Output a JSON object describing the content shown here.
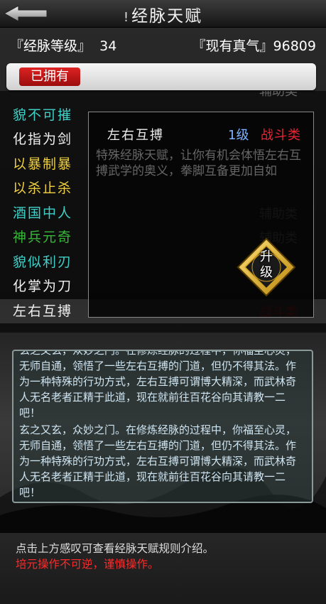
{
  "header": {
    "title": "经脉天赋",
    "info_mark": "!"
  },
  "stats": {
    "level_label": "『经脉等级』",
    "level_value": "34",
    "qi_label": "『现有真气』",
    "qi_value": "96809"
  },
  "filter": {
    "owned_label": "已拥有"
  },
  "list": [
    {
      "name": "",
      "cat": "辅助类",
      "color": "#d8c060"
    },
    {
      "name": "貌不可摧",
      "cat": "",
      "color": "#3fd0c8"
    },
    {
      "name": "化指为剑",
      "cat": "",
      "color": "#f0f0f0"
    },
    {
      "name": "以暴制暴",
      "cat": "",
      "color": "#f0d040"
    },
    {
      "name": "以杀止杀",
      "cat": "",
      "color": "#f0d040"
    },
    {
      "name": "酒国中人",
      "cat": "辅助类",
      "color": "#3fd0c8"
    },
    {
      "name": "神兵元奇",
      "cat": "辅助类",
      "color": "#38b83a"
    },
    {
      "name": "貌似利刃",
      "cat": "",
      "color": "#3fd0c8"
    },
    {
      "name": "化掌为刀",
      "cat": "",
      "color": "#f0f0f0"
    },
    {
      "name": "左右互搏",
      "cat": "战斗类",
      "color": "#f0f0f0"
    }
  ],
  "popup": {
    "name": "左右互搏",
    "level": "1级",
    "category": "战斗类",
    "description": "特殊经脉天赋，让你有机会体悟左右互搏武学的奥义，拳脚互备更加自如",
    "upgrade_label_1": "升",
    "upgrade_label_2": "级"
  },
  "story": {
    "paragraph_1": "玄之又玄，众妙之门。在修炼经脉的过程中，你福至心灵，无师自通，领悟了一些左右互搏的门道，但仍不得其法。作为一种特殊的行功方式，左右互搏可谓博大精深，而武林奇人无名老者正精于此道，现在就前往百花谷向其请教一二吧！",
    "paragraph_2": "玄之又玄，众妙之门。在修炼经脉的过程中，你福至心灵，无师自通，领悟了一些左右互搏的门道，但仍不得其法。作为一种特殊的行功方式，左右互搏可谓博大精深，而武林奇人无名老者正精于此道，现在就前往百花谷向其请教一二吧！"
  },
  "footer": {
    "hint": "点击上方感叹可查看经脉天赋规则介绍。",
    "warning": "培元操作不可逆，谨慎操作。"
  },
  "colors": {
    "accent_red": "#d22222",
    "level_blue": "#7db3ff",
    "story_text": "#cfe6f3"
  }
}
